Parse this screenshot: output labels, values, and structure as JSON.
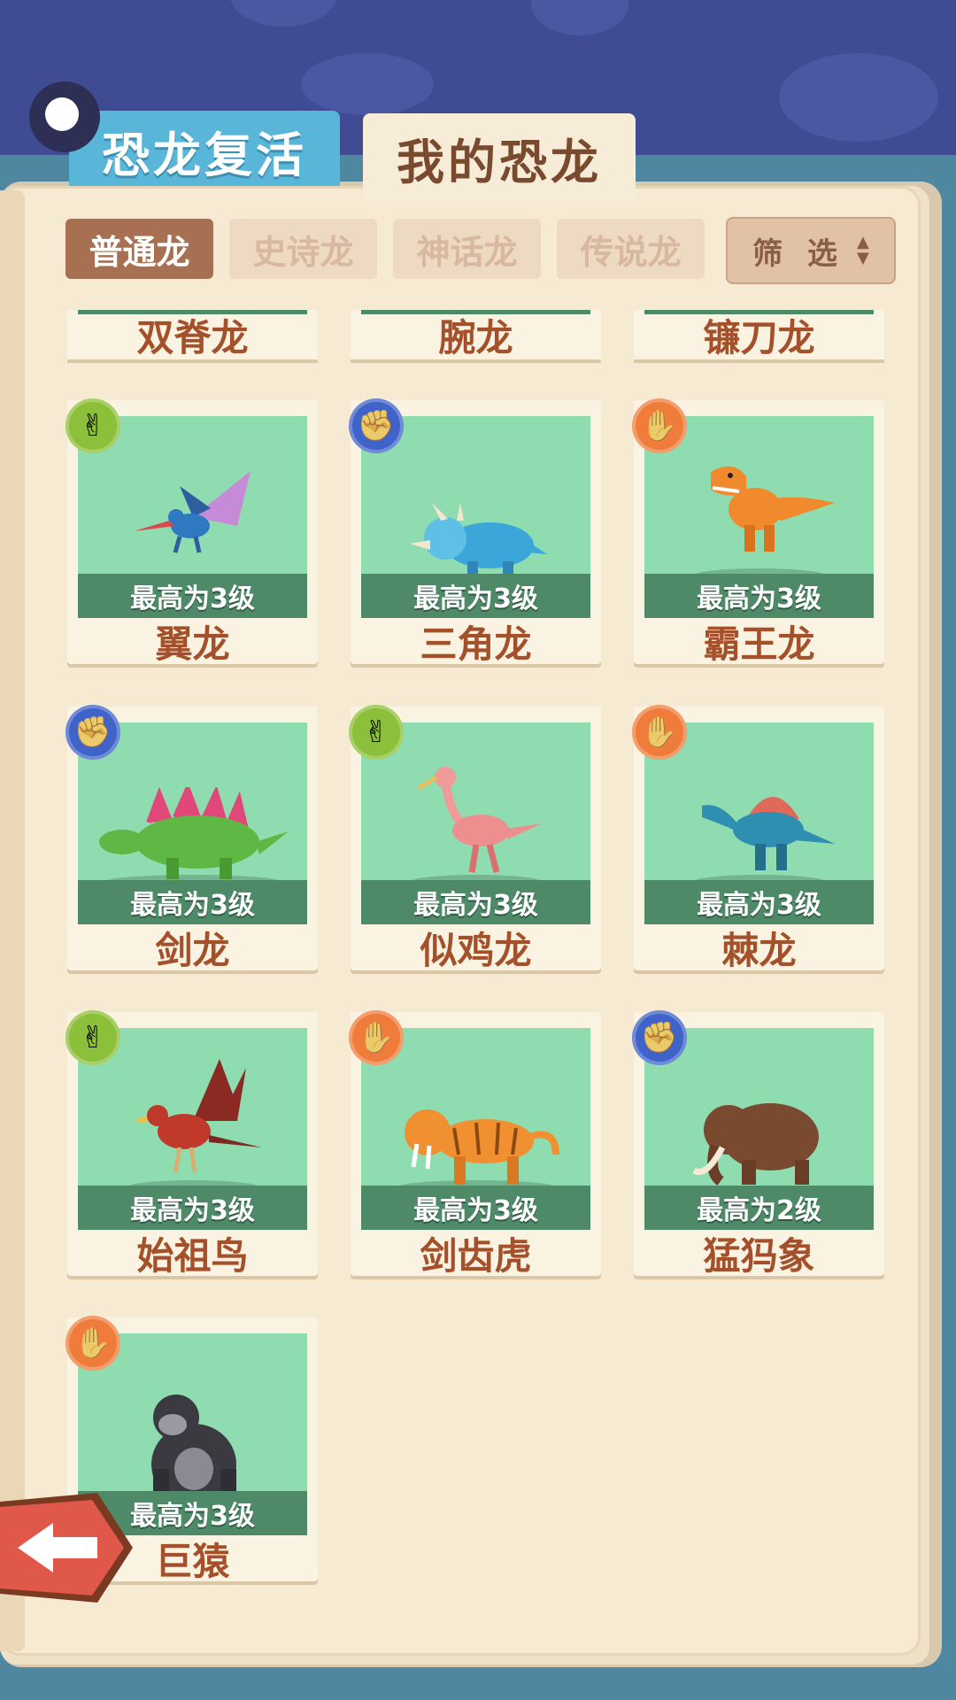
{
  "tabs": [
    {
      "label": "恐龙复活",
      "active": false
    },
    {
      "label": "我的恐龙",
      "active": true
    }
  ],
  "filters": {
    "chips": [
      {
        "label": "普通龙",
        "active": true
      },
      {
        "label": "史诗龙",
        "active": false
      },
      {
        "label": "神话龙",
        "active": false
      },
      {
        "label": "传说龙",
        "active": false
      }
    ],
    "filter_button_label": "筛 选"
  },
  "partial_row": [
    "双脊龙",
    "腕龙",
    "镰刀龙"
  ],
  "cards": [
    {
      "name": "翼龙",
      "level": "最高为3级",
      "type": "scissors",
      "icon": "pterosaur-icon"
    },
    {
      "name": "三角龙",
      "level": "最高为3级",
      "type": "rock",
      "icon": "triceratops-icon"
    },
    {
      "name": "霸王龙",
      "level": "最高为3级",
      "type": "paper",
      "icon": "trex-icon"
    },
    {
      "name": "剑龙",
      "level": "最高为3级",
      "type": "rock",
      "icon": "stegosaurus-icon"
    },
    {
      "name": "似鸡龙",
      "level": "最高为3级",
      "type": "scissors",
      "icon": "gallimimus-icon"
    },
    {
      "name": "棘龙",
      "level": "最高为3级",
      "type": "paper",
      "icon": "spinosaurus-icon"
    },
    {
      "name": "始祖鸟",
      "level": "最高为3级",
      "type": "scissors",
      "icon": "archaeopteryx-icon"
    },
    {
      "name": "剑齿虎",
      "level": "最高为3级",
      "type": "paper",
      "icon": "sabertooth-icon"
    },
    {
      "name": "猛犸象",
      "level": "最高为2级",
      "type": "rock",
      "icon": "mammoth-icon"
    },
    {
      "name": "巨猿",
      "level": "最高为3级",
      "type": "paper",
      "icon": "gorilla-icon"
    }
  ],
  "colors": {
    "card_bg": "#8fdcb0",
    "name_text": "#a4512b",
    "scissors_badge": "#8cbf3a",
    "rock_badge": "#3f63c8",
    "paper_badge": "#f07c3c"
  }
}
